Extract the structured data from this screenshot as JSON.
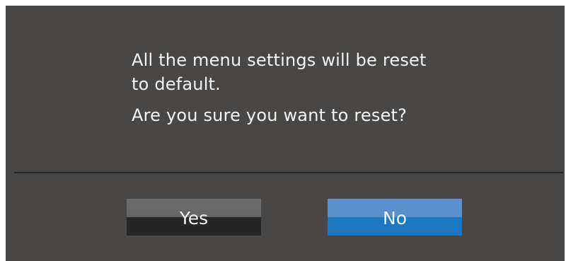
{
  "dialog": {
    "message_line1": "All the menu settings will be reset",
    "message_line2": "to default.",
    "question": "Are you sure you want to reset?",
    "yes_label": "Yes",
    "no_label": "No",
    "selected": "No",
    "colors": {
      "background": "#494745",
      "text": "#f4f4f4",
      "yes_top": "#6c6c6c",
      "yes_bottom": "#262626",
      "no_top": "#5a91cf",
      "no_bottom": "#1c79c1"
    }
  }
}
